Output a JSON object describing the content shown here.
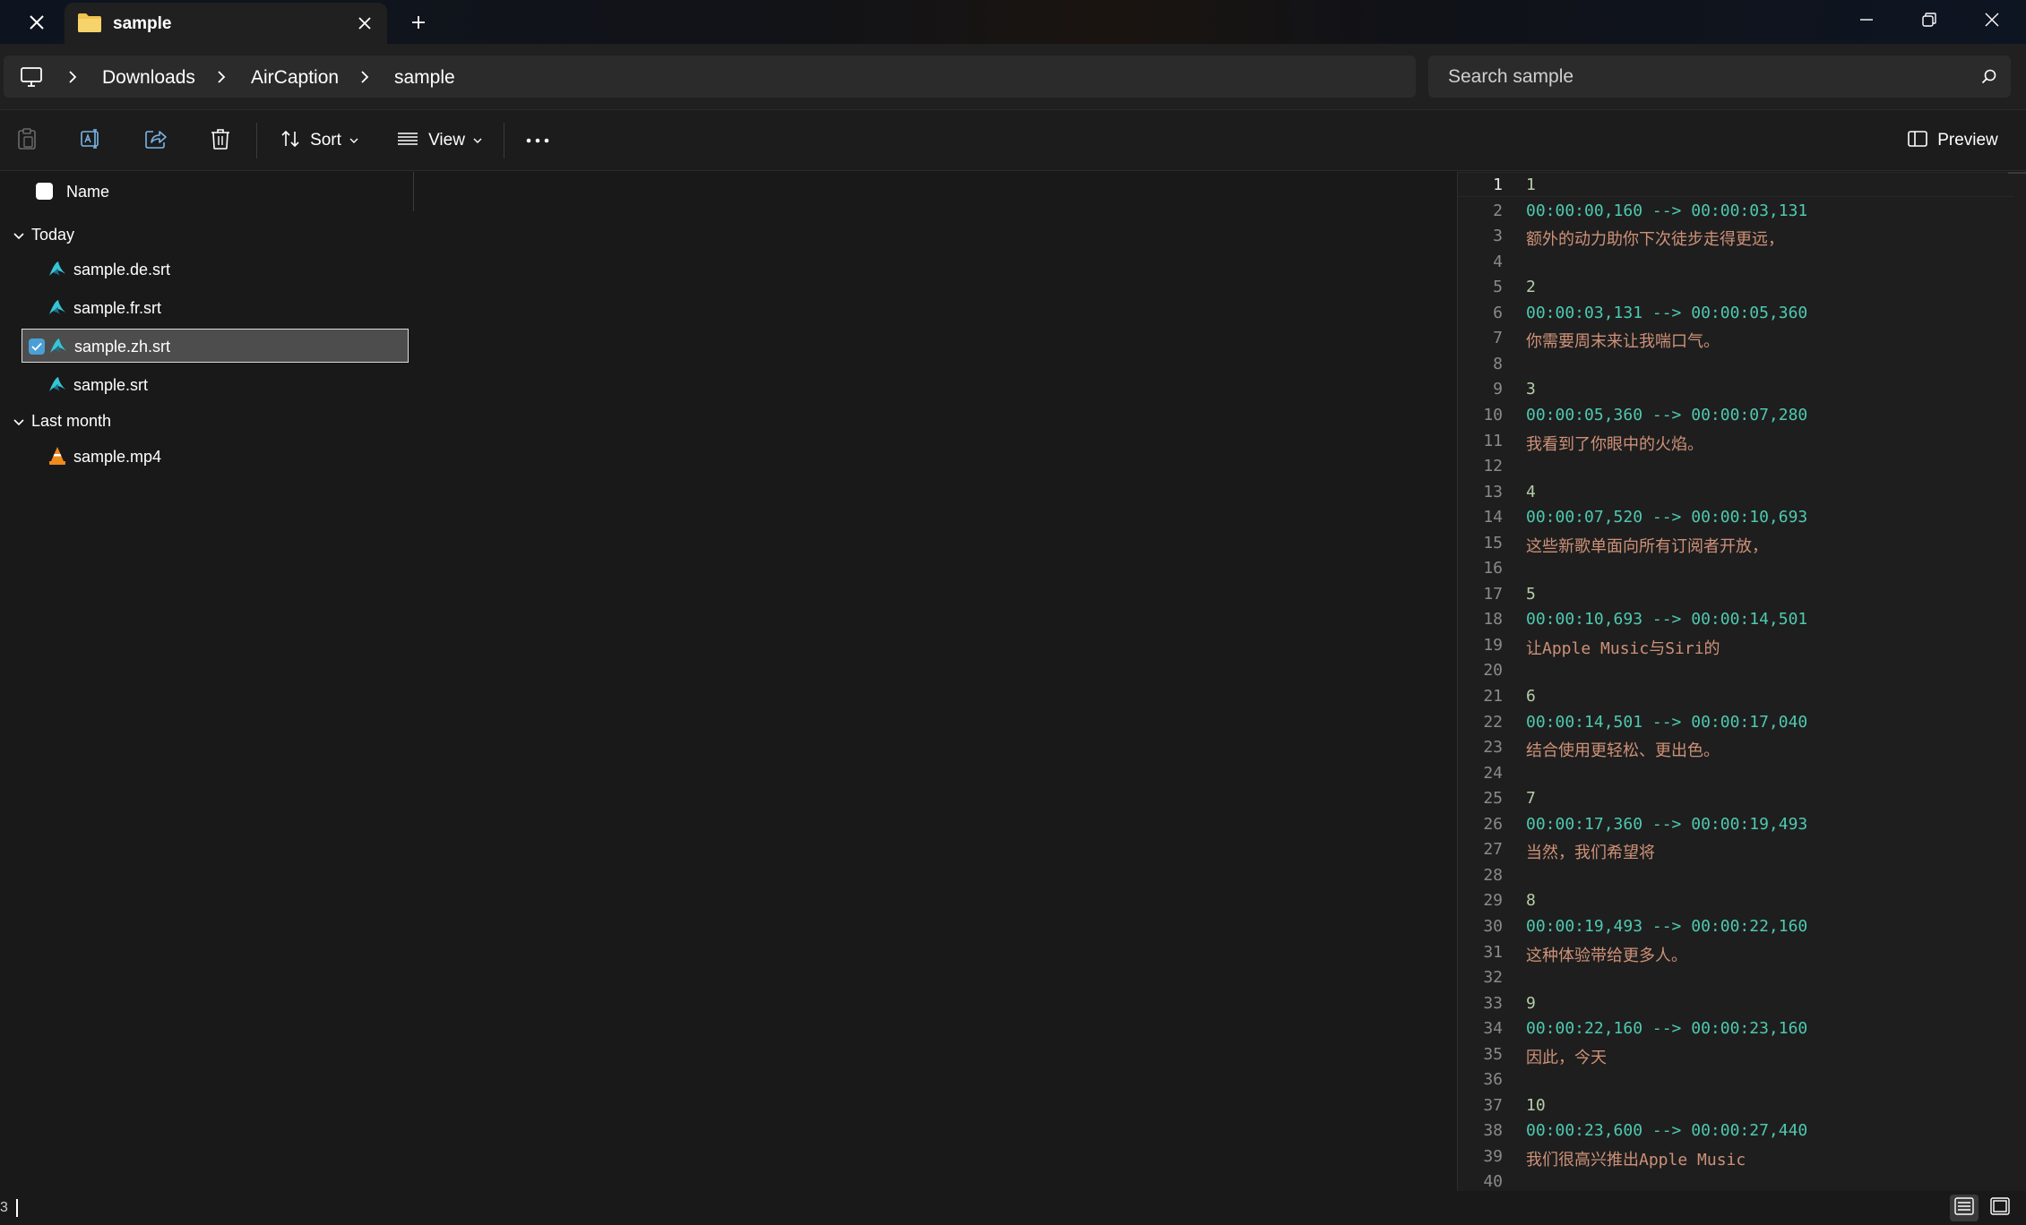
{
  "tab": {
    "title": "sample"
  },
  "breadcrumb": [
    "Downloads",
    "AirCaption",
    "sample"
  ],
  "search": {
    "placeholder": "Search sample"
  },
  "toolbar": {
    "sort_label": "Sort",
    "view_label": "View",
    "preview_label": "Preview"
  },
  "file_list": {
    "header_name": "Name",
    "groups": [
      {
        "label": "Today",
        "files": [
          {
            "name": "sample.de.srt",
            "icon": "aircaption-icon"
          },
          {
            "name": "sample.fr.srt",
            "icon": "aircaption-icon"
          },
          {
            "name": "sample.zh.srt",
            "icon": "aircaption-icon",
            "selected": true
          },
          {
            "name": "sample.srt",
            "icon": "aircaption-icon"
          }
        ]
      },
      {
        "label": "Last month",
        "files": [
          {
            "name": "sample.mp4",
            "icon": "vlc-cone-icon"
          }
        ]
      }
    ]
  },
  "preview": {
    "active_line": 1,
    "lines": [
      {
        "n": "1",
        "text": "1",
        "kind": "num"
      },
      {
        "n": "2",
        "text": "00:00:00,160 --> 00:00:03,131",
        "kind": "time"
      },
      {
        "n": "3",
        "text": "额外的动力助你下次徒步走得更远，",
        "kind": "text"
      },
      {
        "n": "4",
        "text": "",
        "kind": "blank"
      },
      {
        "n": "5",
        "text": "2",
        "kind": "num"
      },
      {
        "n": "6",
        "text": "00:00:03,131 --> 00:00:05,360",
        "kind": "time"
      },
      {
        "n": "7",
        "text": "你需要周末来让我喘口气。",
        "kind": "text"
      },
      {
        "n": "8",
        "text": "",
        "kind": "blank"
      },
      {
        "n": "9",
        "text": "3",
        "kind": "num"
      },
      {
        "n": "10",
        "text": "00:00:05,360 --> 00:00:07,280",
        "kind": "time"
      },
      {
        "n": "11",
        "text": "我看到了你眼中的火焰。",
        "kind": "text"
      },
      {
        "n": "12",
        "text": "",
        "kind": "blank"
      },
      {
        "n": "13",
        "text": "4",
        "kind": "num"
      },
      {
        "n": "14",
        "text": "00:00:07,520 --> 00:00:10,693",
        "kind": "time"
      },
      {
        "n": "15",
        "text": "这些新歌单面向所有订阅者开放，",
        "kind": "text"
      },
      {
        "n": "16",
        "text": "",
        "kind": "blank"
      },
      {
        "n": "17",
        "text": "5",
        "kind": "num"
      },
      {
        "n": "18",
        "text": "00:00:10,693 --> 00:00:14,501",
        "kind": "time"
      },
      {
        "n": "19",
        "text": "让Apple Music与Siri的",
        "kind": "text"
      },
      {
        "n": "20",
        "text": "",
        "kind": "blank"
      },
      {
        "n": "21",
        "text": "6",
        "kind": "num"
      },
      {
        "n": "22",
        "text": "00:00:14,501 --> 00:00:17,040",
        "kind": "time"
      },
      {
        "n": "23",
        "text": "结合使用更轻松、更出色。",
        "kind": "text"
      },
      {
        "n": "24",
        "text": "",
        "kind": "blank"
      },
      {
        "n": "25",
        "text": "7",
        "kind": "num"
      },
      {
        "n": "26",
        "text": "00:00:17,360 --> 00:00:19,493",
        "kind": "time"
      },
      {
        "n": "27",
        "text": "当然，我们希望将",
        "kind": "text"
      },
      {
        "n": "28",
        "text": "",
        "kind": "blank"
      },
      {
        "n": "29",
        "text": "8",
        "kind": "num"
      },
      {
        "n": "30",
        "text": "00:00:19,493 --> 00:00:22,160",
        "kind": "time"
      },
      {
        "n": "31",
        "text": "这种体验带给更多人。",
        "kind": "text"
      },
      {
        "n": "32",
        "text": "",
        "kind": "blank"
      },
      {
        "n": "33",
        "text": "9",
        "kind": "num"
      },
      {
        "n": "34",
        "text": "00:00:22,160 --> 00:00:23,160",
        "kind": "time"
      },
      {
        "n": "35",
        "text": "因此，今天",
        "kind": "text"
      },
      {
        "n": "36",
        "text": "",
        "kind": "blank"
      },
      {
        "n": "37",
        "text": "10",
        "kind": "num"
      },
      {
        "n": "38",
        "text": "00:00:23,600 --> 00:00:27,440",
        "kind": "time"
      },
      {
        "n": "39",
        "text": "我们很高兴推出Apple Music",
        "kind": "text"
      },
      {
        "n": "40",
        "text": "",
        "kind": "blank"
      }
    ]
  },
  "status": {
    "left_glyph": "3"
  },
  "colors": {
    "background": "#191919",
    "selection": "#4d4d4d",
    "accent": "#4a9fd8",
    "srt_number": "#b5cea8",
    "srt_time": "#4ec9b0",
    "srt_text": "#ce9178",
    "folder": "#f2c14e",
    "aircaption": "#35c6d6",
    "vlc": "#f08a1c"
  }
}
